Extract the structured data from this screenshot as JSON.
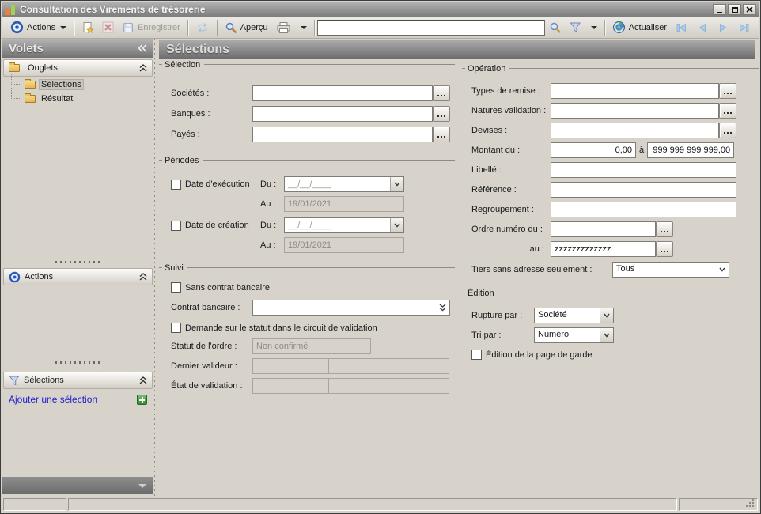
{
  "window": {
    "title": "Consultation des Virements de trésorerie"
  },
  "toolbar": {
    "actions_label": "Actions",
    "save_label": "Enregistrer",
    "preview_label": "Aperçu",
    "search_value": "",
    "refresh_label": "Actualiser"
  },
  "sidebar": {
    "caption": "Volets",
    "onglets": {
      "label": "Onglets",
      "items": [
        {
          "label": "Sélections"
        },
        {
          "label": "Résultat"
        }
      ]
    },
    "actions": {
      "label": "Actions"
    },
    "selections": {
      "label": "Sélections",
      "add_link": "Ajouter une sélection"
    }
  },
  "main": {
    "title": "Sélections",
    "selection": {
      "title": "Sélection",
      "societes": "Sociétés :",
      "banques": "Banques :",
      "payes": "Payés :"
    },
    "periodes": {
      "title": "Périodes",
      "date_execution": "Date d'exécution",
      "date_creation": "Date de création",
      "du": "Du :",
      "au": "Au :",
      "du_placeholder": "__/__/____",
      "au_value": "19/01/2021"
    },
    "suivi": {
      "title": "Suivi",
      "sans_contrat": "Sans contrat bancaire",
      "contrat": "Contrat bancaire :",
      "demande_statut": "Demande sur le statut dans le circuit de validation",
      "statut_ordre": "Statut de l'ordre :",
      "statut_value": "Non confirmé",
      "dernier_valideur": "Dernier valideur :",
      "etat_validation": "État de validation :"
    },
    "operation": {
      "title": "Opération",
      "types_remise": "Types de remise :",
      "natures_validation": "Natures validation :",
      "devises": "Devises :",
      "montant_du": "Montant du :",
      "montant_min": "0,00",
      "a_label": "à",
      "montant_max": "999 999 999 999,00",
      "libelle": "Libellé :",
      "reference": "Référence :",
      "regroupement": "Regroupement :",
      "ordre_numero_du": "Ordre numéro du :",
      "au": "au :",
      "au_value": "zzzzzzzzzzzzz",
      "tiers": "Tiers sans adresse seulement :",
      "tiers_value": "Tous"
    },
    "edition": {
      "title": "Édition",
      "rupture_par": "Rupture par :",
      "rupture_value": "Société",
      "tri_par": "Tri par :",
      "tri_value": "Numéro",
      "page_garde": "Édition de la page de garde"
    }
  },
  "colors": {
    "header_gradient_top": "#b0b0b0",
    "header_gradient_bottom": "#727272",
    "link_blue": "#2121cb",
    "add_button_green": "#2f8d2f",
    "logo_orange": "#e8813a",
    "logo_green": "#a6cf4f"
  }
}
